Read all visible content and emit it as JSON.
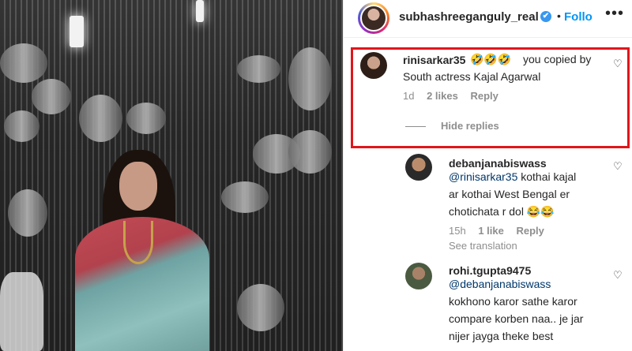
{
  "post": {
    "username": "subhashreeganguly_real",
    "verified": "✔",
    "separator": "•",
    "follow_label": "Follo",
    "more_label": "•••"
  },
  "comments": [
    {
      "username": "rinisarkar35",
      "emoji": "🤣🤣🤣",
      "text_line1": "you copied by",
      "text_line2": "South actress Kajal Agarwal",
      "time": "1d",
      "likes": "2 likes",
      "reply_label": "Reply",
      "hide_replies_label": "Hide replies"
    }
  ],
  "replies": [
    {
      "username": "debanjanabiswass",
      "mention": "@rinisarkar35",
      "text_line1": " kothai kajal",
      "text_line2": "ar kothai West Bengal er",
      "text_line3": "chotichata r dol 😂😂",
      "time": "15h",
      "likes": "1 like",
      "reply_label": "Reply",
      "translation_label": "See translation"
    },
    {
      "username": "rohi.tgupta9475",
      "mention": "@debanjanabiswass",
      "text_line1": "kokhono karor sathe karor",
      "text_line2": "compare korben naa.. je jar",
      "text_line3": "nijer jayga theke best"
    }
  ],
  "icons": {
    "heart": "♡"
  },
  "colors": {
    "highlight": "#e0161b",
    "follow": "#0095f6",
    "mention": "#00376b",
    "meta": "#8e8e8e"
  }
}
